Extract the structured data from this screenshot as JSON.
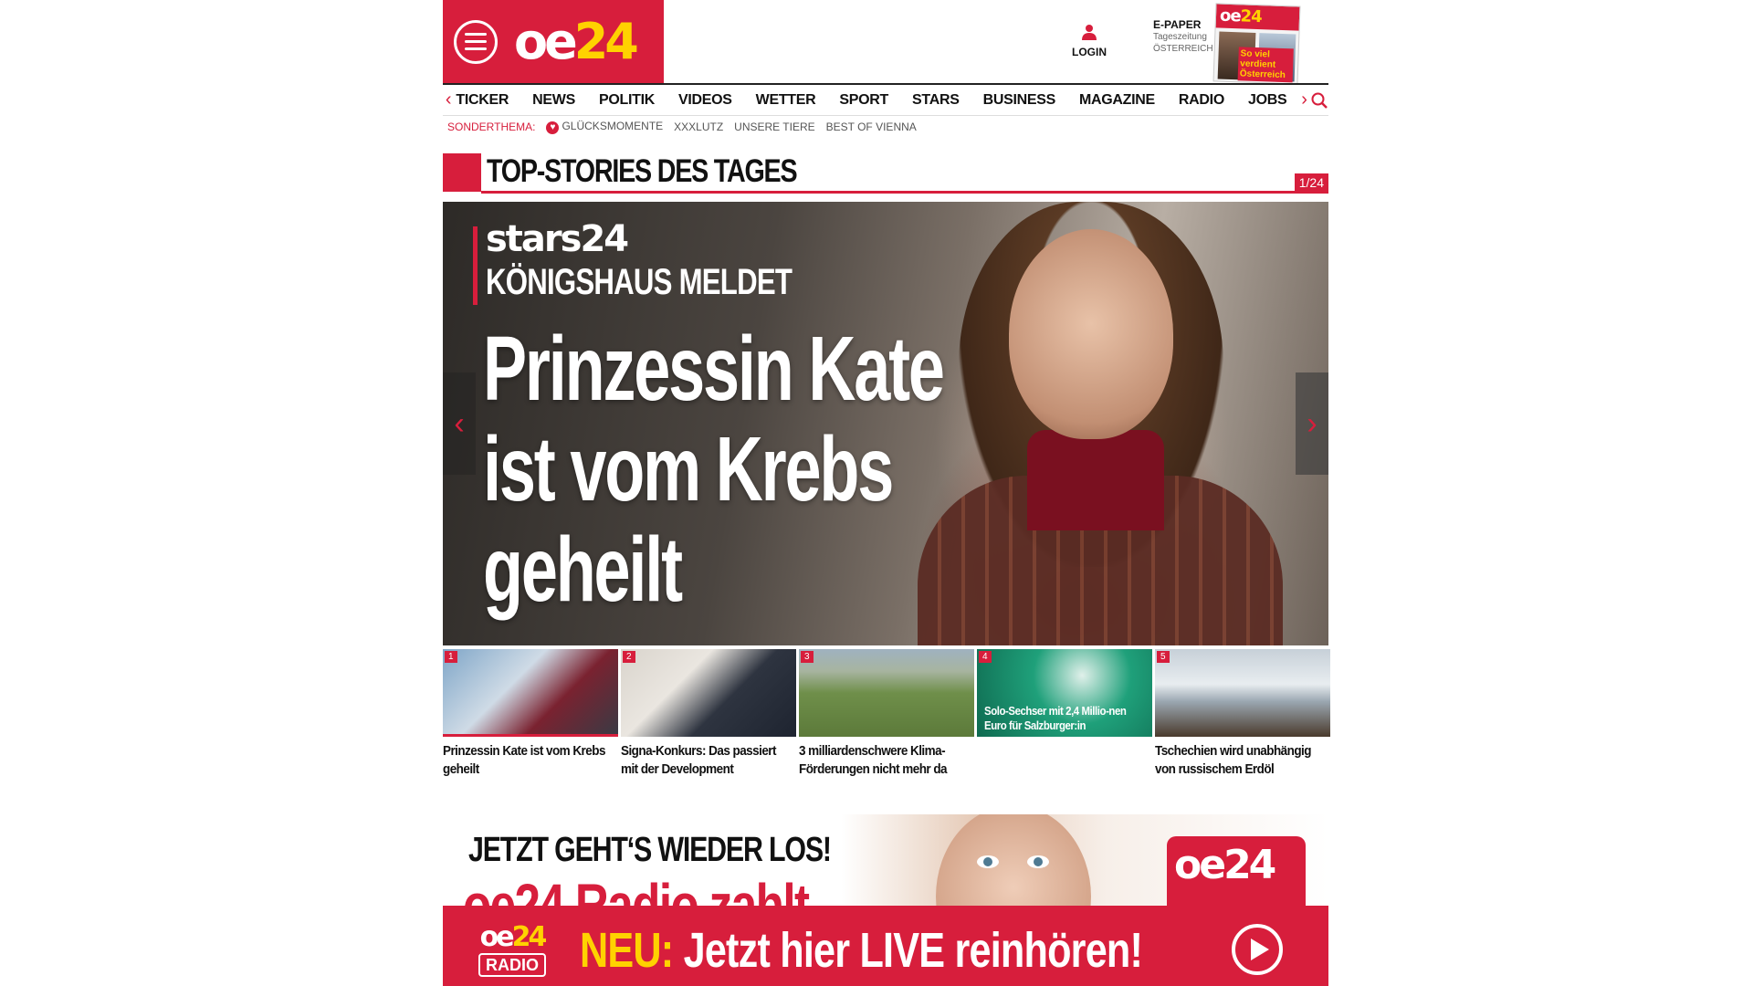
{
  "header": {
    "logo_main": "oe",
    "logo_num": "24",
    "login_label": "LOGIN",
    "epaper": {
      "title": "E-PAPER",
      "line1": "Tageszeitung",
      "line2": "ÖSTERREICH"
    },
    "cover": {
      "logo_main": "oe",
      "logo_num": "24",
      "headline": "So viel verdient Österreich"
    }
  },
  "nav": {
    "items": [
      "TICKER",
      "NEWS",
      "POLITIK",
      "VIDEOS",
      "WETTER",
      "SPORT",
      "STARS",
      "BUSINESS",
      "MAGAZINE",
      "RADIO",
      "JOBS"
    ]
  },
  "sonderthema": {
    "label": "SONDERTHEMA:",
    "links": [
      "GLÜCKSMOMENTE",
      "XXXLUTZ",
      "UNSERE TIERE",
      "BEST OF VIENNA"
    ]
  },
  "section": {
    "title": "TOP-STORIES DES TAGES",
    "counter": "1/24"
  },
  "hero": {
    "brand": "stars24",
    "kicker": "KÖNIGSHAUS MELDET",
    "headline": "Prinzessin Kate ist vom Krebs geheilt"
  },
  "thumbs": [
    {
      "num": "1",
      "caption": "Prinzessin Kate ist vom Krebs geheilt",
      "overlay": ""
    },
    {
      "num": "2",
      "caption": "Signa-Konkurs: Das passiert mit der Development",
      "overlay": ""
    },
    {
      "num": "3",
      "caption": "3 milliardenschwere Klima-Förderungen nicht mehr da",
      "overlay": ""
    },
    {
      "num": "4",
      "caption": "",
      "overlay": "Solo-Sechser mit 2,4 Millio-nen Euro für Salzburger:in"
    },
    {
      "num": "5",
      "caption": "Tschechien wird unabhängig von russischem Erdöl",
      "overlay": ""
    }
  ],
  "ad": {
    "headline": "JETZT GEHT‘S WIEDER LOS!",
    "subline": "oe24 Radio zahlt",
    "logo_main": "oe24"
  },
  "radio": {
    "logo_main": "oe",
    "logo_num": "24",
    "logo_sub": "RADIO",
    "prefix": "NEU:",
    "message": " Jetzt hier LIVE reinhören!"
  },
  "colors": {
    "brand_red": "#d71e3c",
    "accent_yellow": "#ffd200"
  }
}
